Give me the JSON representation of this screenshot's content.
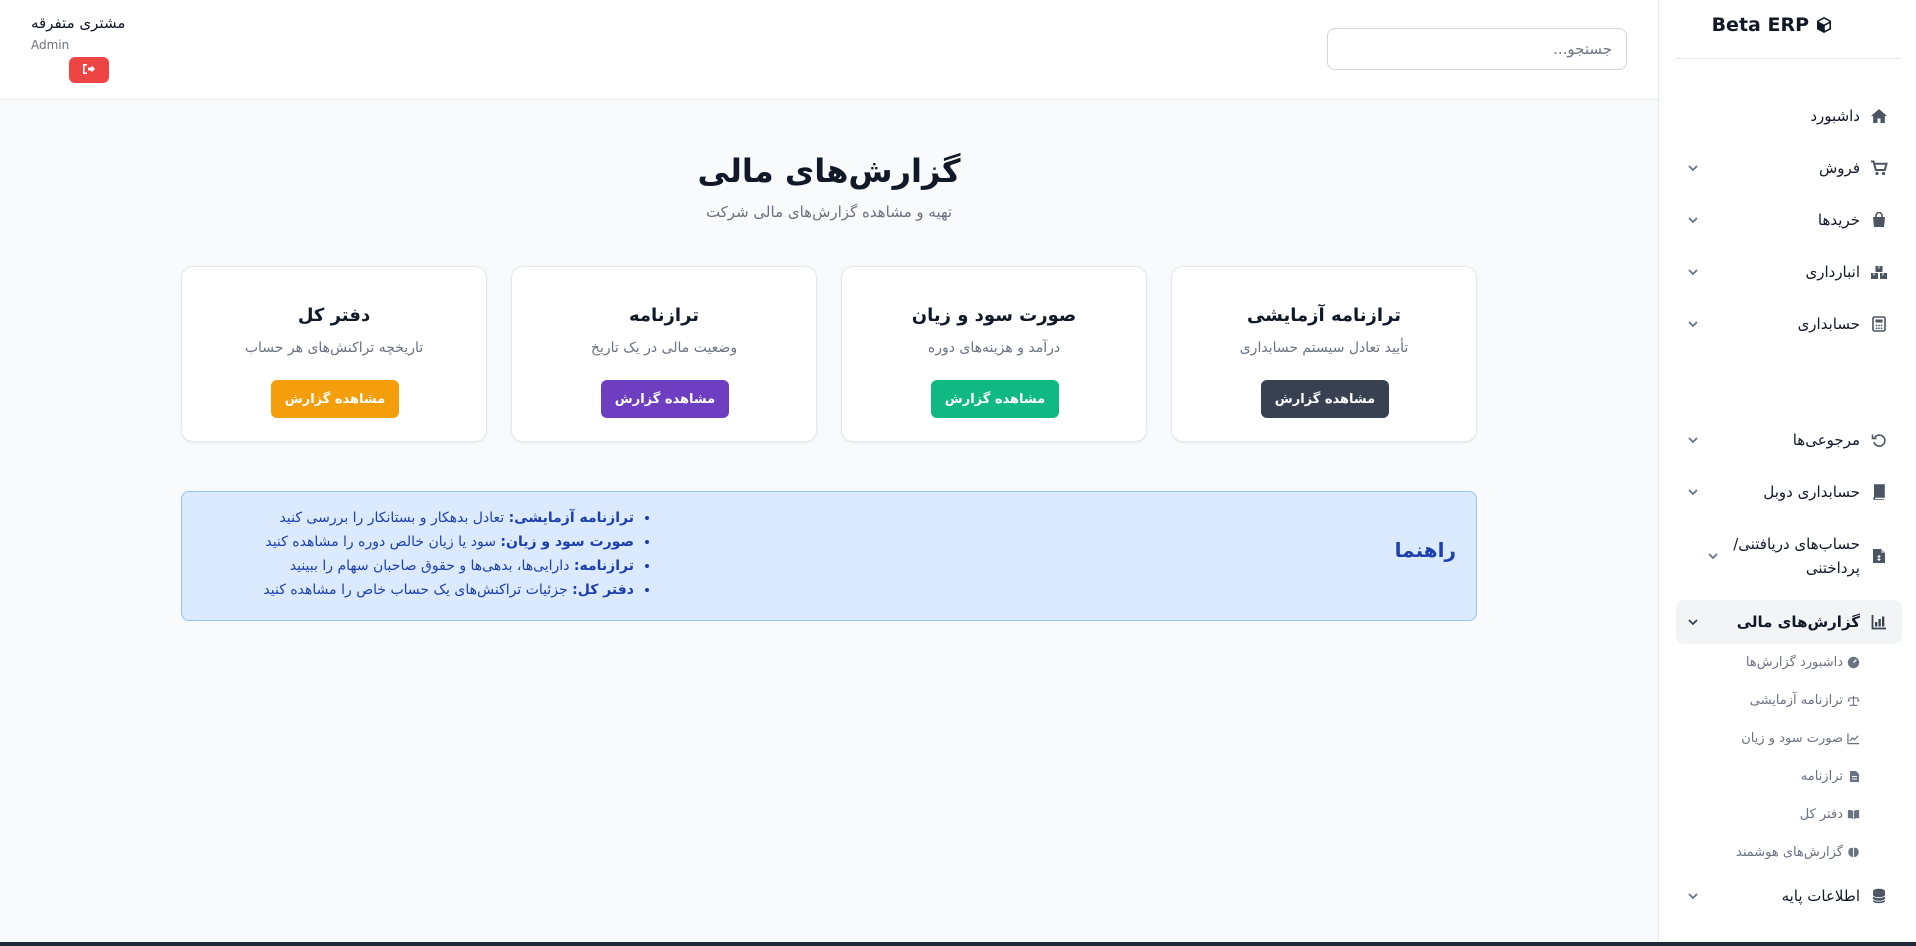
{
  "brand": {
    "name": "Beta ERP",
    "icon": "cube-icon"
  },
  "search": {
    "placeholder": "جستجو..."
  },
  "user": {
    "name": "مشتری متفرقه",
    "role": "Admin",
    "logout_icon": "sign-out-icon"
  },
  "sidebar": {
    "items": [
      {
        "label": "داشبورد",
        "icon": "home-icon",
        "has_children": false
      },
      {
        "label": "فروش",
        "icon": "cart-icon",
        "has_children": true
      },
      {
        "label": "خریدها",
        "icon": "bag-icon",
        "has_children": true
      },
      {
        "label": "انبارداری",
        "icon": "warehouse-icon",
        "has_children": true
      },
      {
        "label": "حسابداری",
        "icon": "calculator-icon",
        "has_children": true
      },
      {
        "label": "مرجوعی‌ها",
        "icon": "undo-icon",
        "has_children": true
      },
      {
        "label": "حسابداری دوبل",
        "icon": "book-icon",
        "has_children": true
      },
      {
        "label": "حساب‌های دریافتنی/پرداختنی",
        "icon": "invoice-icon",
        "has_children": true
      },
      {
        "label": "گزارش‌های مالی",
        "icon": "chart-icon",
        "has_children": true,
        "active": true
      },
      {
        "label": "اطلاعات پایه",
        "icon": "database-icon",
        "has_children": true
      }
    ],
    "sub_items": [
      {
        "label": "داشبورد گزارش‌ها",
        "icon": "gauge-icon"
      },
      {
        "label": "ترازنامه آزمایشی",
        "icon": "scale-icon"
      },
      {
        "label": "صورت سود و زیان",
        "icon": "line-chart-icon"
      },
      {
        "label": "ترازنامه",
        "icon": "file-icon"
      },
      {
        "label": "دفتر کل",
        "icon": "open-book-icon"
      },
      {
        "label": "گزارش‌های هوشمند",
        "icon": "brain-icon"
      }
    ]
  },
  "main": {
    "title": "گزارش‌های مالی",
    "subtitle": "تهیه و مشاهده گزارش‌های مالی شرکت",
    "cards": [
      {
        "title": "ترازنامه آزمایشی",
        "description": "تأیید تعادل سیستم حسابداری",
        "button": "مشاهده گزارش",
        "color": "#374151"
      },
      {
        "title": "صورت سود و زیان",
        "description": "درآمد و هزینه‌های دوره",
        "button": "مشاهده گزارش",
        "color": "#10b981"
      },
      {
        "title": "ترازنامه",
        "description": "وضعیت مالی در یک تاریخ",
        "button": "مشاهده گزارش",
        "color": "#6d3fc0"
      },
      {
        "title": "دفتر کل",
        "description": "تاریخچه تراکنش‌های هر حساب",
        "button": "مشاهده گزارش",
        "color": "#f59e0b"
      }
    ],
    "guide": {
      "title": "راهنما",
      "items": [
        {
          "term": "ترازنامه آزمایشی:",
          "text": "تعادل بدهکار و بستانکار را بررسی کنید"
        },
        {
          "term": "صورت سود و زیان:",
          "text": "سود یا زیان خالص دوره را مشاهده کنید"
        },
        {
          "term": "ترازنامه:",
          "text": "دارایی‌ها، بدهی‌ها و حقوق صاحبان سهام را ببینید"
        },
        {
          "term": "دفتر کل:",
          "text": "جزئیات تراکنش‌های یک حساب خاص را مشاهده کنید"
        }
      ]
    }
  }
}
